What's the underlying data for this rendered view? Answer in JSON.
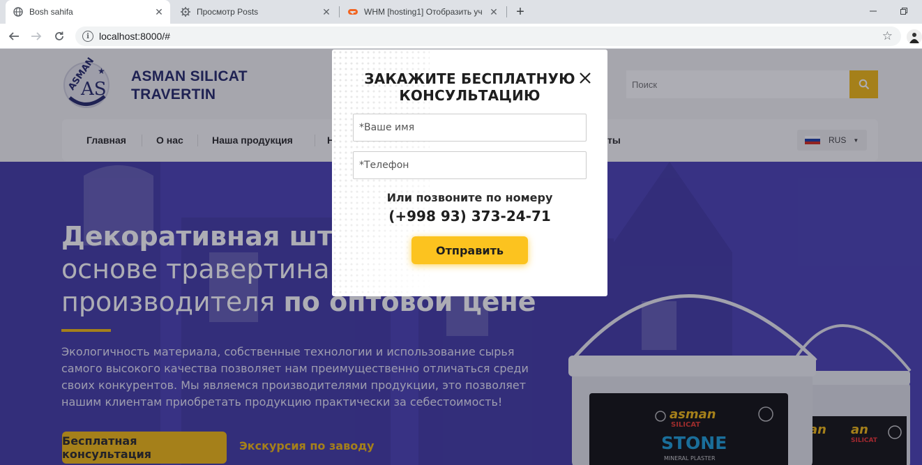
{
  "browser": {
    "tabs": [
      {
        "label": "Bosh sahifa",
        "icon": "globe-icon",
        "active": true
      },
      {
        "label": "Просмотр Posts",
        "icon": "gear-icon",
        "active": false
      },
      {
        "label": "WHM [hosting1] Отобразить уч",
        "icon": "cpanel-icon",
        "active": false
      }
    ],
    "url": "localhost:8000/#"
  },
  "site": {
    "brand_line1": "ASMAN SILICAT",
    "brand_line2": "TRAVERTIN",
    "logo_text": "ASMAN",
    "search_placeholder": "Поиск",
    "menu": [
      "Главная",
      "О нас",
      "Наша продукция",
      "Н",
      "ты"
    ],
    "language": "RUS"
  },
  "hero": {
    "title_bold": "Декоративная шту",
    "title_line2": "основе травертина",
    "title_line3_plain": "производителя ",
    "title_line3_bold": "по оптовой цене",
    "text": "Экологичность материала, собственные технологии и использование сырья самого высокого качества позволяет нам преимущественно отличаться среди своих конкурентов. Мы являемся производителями продукции, это позволяет нашим клиентам приобретать продукцию практически за себестоимость!",
    "primary_button": "Бесплатная консультация",
    "secondary_link": "Экскурсия по заводу",
    "product_brand": "asman",
    "product_sub": "SILICAT",
    "product_name": "STONE",
    "product_type": "MINERAL PLASTER"
  },
  "modal": {
    "title": "ЗАКАЖИТЕ БЕСПЛАТНУЮ КОНСУЛЬТАЦИЮ",
    "name_placeholder": "*Ваше имя",
    "phone_placeholder": "*Телефон",
    "call_text": "Или позвоните по номеру",
    "phone": "(+998 93) 373-24-71",
    "submit": "Отправить"
  },
  "colors": {
    "accent": "#f3bb13",
    "brand": "#262a6b",
    "hero_bg": "#4b42b5"
  }
}
